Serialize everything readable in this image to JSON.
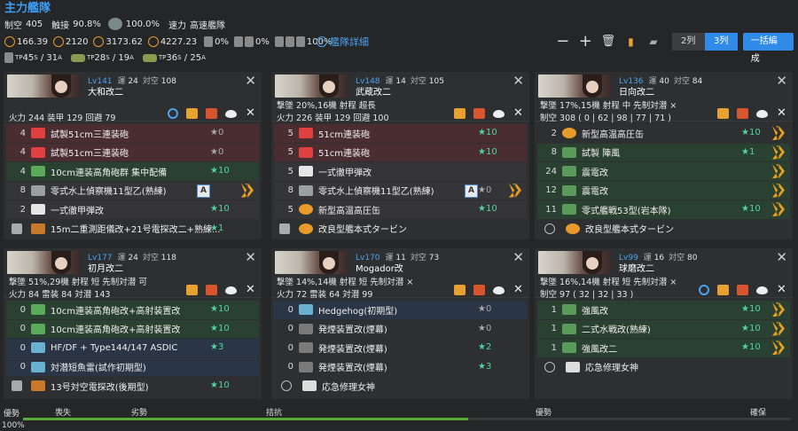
{
  "fleet": {
    "title": "主力艦隊",
    "stats": [
      {
        "label": "制空",
        "value": "405"
      },
      {
        "label": "触接",
        "value": "90.8%"
      },
      {
        "label": "",
        "value": "100.0%"
      },
      {
        "label": "速力",
        "value": "高速艦隊"
      }
    ],
    "los": [
      "166.39",
      "2120",
      "3173.62",
      "4227.23"
    ],
    "trans": [
      "0%",
      "0%",
      "100%"
    ],
    "tp": [
      "45",
      "31",
      "28",
      "19",
      "36",
      "25"
    ],
    "detail": "艦隊詳細",
    "col2": "2列",
    "col3": "3列",
    "form": "一括編成"
  },
  "ships": [
    {
      "lv": "Lv141",
      "unlabel": "運",
      "un": "24",
      "aalabel": "対空",
      "aa": "108",
      "name": "大和改二",
      "s1": "火力 244 装甲 129 回避 79",
      "s2": "",
      "slots": [
        {
          "c": "4",
          "n": "試製51cm三連装砲",
          "i": "★0",
          "k": "red",
          "ic": "gun",
          "g": 0
        },
        {
          "c": "4",
          "n": "試製51cm三連装砲",
          "i": "★0",
          "k": "red",
          "ic": "gun",
          "g": 0
        },
        {
          "c": "4",
          "n": "10cm連装高角砲群 集中配備",
          "i": "★10",
          "k": "grn",
          "ic": "aa",
          "g": 1
        },
        {
          "c": "8",
          "n": "零式水上偵察機11型乙(熟練)",
          "i": "",
          "k": "gry",
          "ic": "sea",
          "g": 0,
          "a": "A",
          "r": 1
        },
        {
          "c": "2",
          "n": "一式徹甲弾改",
          "i": "★10",
          "k": "gry",
          "ic": "drop",
          "g": 1
        },
        {
          "c": "",
          "n": "15m二重測距儀改+21号電探改二+熟練...",
          "i": "★1",
          "k": "dark",
          "ic": "radar",
          "g": 1,
          "w": 1
        }
      ]
    },
    {
      "lv": "Lv148",
      "unlabel": "運",
      "un": "14",
      "aalabel": "対空",
      "aa": "105",
      "name": "武蔵改二",
      "s1": "撃墜 20%,16機 射程 超長",
      "s2": "火力 226 装甲 129 回避 100",
      "slots": [
        {
          "c": "5",
          "n": "51cm連装砲",
          "i": "★10",
          "k": "red",
          "ic": "gun",
          "g": 1
        },
        {
          "c": "5",
          "n": "51cm連装砲",
          "i": "★10",
          "k": "red",
          "ic": "gun",
          "g": 1
        },
        {
          "c": "5",
          "n": "一式徹甲弾改",
          "i": "",
          "k": "gry",
          "ic": "drop",
          "g": 0
        },
        {
          "c": "8",
          "n": "零式水上偵察機11型乙(熟練)",
          "i": "★0",
          "k": "gry",
          "ic": "sea",
          "g": 0,
          "a": "A",
          "r": 1
        },
        {
          "c": "5",
          "n": "新型高温高圧缶",
          "i": "★10",
          "k": "gry",
          "ic": "aux",
          "g": 1
        },
        {
          "c": "",
          "n": "改良型艦本式タービン",
          "i": "",
          "k": "dark",
          "ic": "aux",
          "g": 0,
          "w": 1
        }
      ]
    },
    {
      "lv": "Lv136",
      "unlabel": "運",
      "un": "40",
      "aalabel": "対空",
      "aa": "84",
      "name": "日向改二",
      "s1": "撃墜 17%,15機 射程 中 先制対潜 ×",
      "s2": "制空 308 ( 0 | 62 | 98 | 77 | 71 )",
      "slots": [
        {
          "c": "2",
          "n": "新型高温高圧缶",
          "i": "★10",
          "k": "dark",
          "ic": "aux",
          "g": 1,
          "r": 1
        },
        {
          "c": "8",
          "n": "試製 陣風",
          "i": "★1",
          "k": "grn",
          "ic": "fight",
          "g": 1,
          "r": 1
        },
        {
          "c": "24",
          "n": "震電改",
          "i": "",
          "k": "grn",
          "ic": "fight",
          "g": 0,
          "r": 1
        },
        {
          "c": "12",
          "n": "震電改",
          "i": "",
          "k": "grn",
          "ic": "fight",
          "g": 0,
          "r": 1
        },
        {
          "c": "11",
          "n": "零式艦戦53型(岩本隊)",
          "i": "★10",
          "k": "grn",
          "ic": "fight",
          "g": 1,
          "r": 1
        },
        {
          "c": "",
          "n": "改良型艦本式タービン",
          "i": "",
          "k": "dark",
          "ic": "aux",
          "g": 0,
          "ban": 1
        }
      ]
    },
    {
      "lv": "Lv177",
      "unlabel": "運",
      "un": "24",
      "aalabel": "対空",
      "aa": "118",
      "name": "初月改二",
      "s1": "撃墜 51%,29機 射程 短 先制対潜 可",
      "s2": "火力 84 雷装 84 対潜 143",
      "slots": [
        {
          "c": "0",
          "n": "10cm連装高角砲改+高射装置改",
          "i": "★10",
          "k": "grn",
          "ic": "aa",
          "g": 1
        },
        {
          "c": "0",
          "n": "10cm連装高角砲改+高射装置改",
          "i": "★10",
          "k": "grn",
          "ic": "aa",
          "g": 1
        },
        {
          "c": "0",
          "n": "HF/DF + Type144/147 ASDIC",
          "i": "★3",
          "k": "blu",
          "ic": "sonar",
          "g": 1
        },
        {
          "c": "0",
          "n": "対潜短魚雷(試作初期型)",
          "i": "",
          "k": "blu",
          "ic": "sonar",
          "g": 0
        },
        {
          "c": "",
          "n": "13号対空電探改(後期型)",
          "i": "★10",
          "k": "dark",
          "ic": "radar",
          "g": 1,
          "w": 1
        }
      ]
    },
    {
      "lv": "Lv170",
      "unlabel": "運",
      "un": "11",
      "aalabel": "対空",
      "aa": "73",
      "name": "Mogador改",
      "s1": "撃墜 14%,14機 射程 短 先制対潜 ×",
      "s2": "火力 72 雷装 64 対潜 99",
      "slots": [
        {
          "c": "0",
          "n": "Hedgehog(初期型)",
          "i": "★0",
          "k": "blu",
          "ic": "sonar",
          "g": 0
        },
        {
          "c": "0",
          "n": "発煙装置改(煙幕)",
          "i": "★0",
          "k": "dark",
          "ic": "dc",
          "g": 0
        },
        {
          "c": "0",
          "n": "発煙装置改(煙幕)",
          "i": "★2",
          "k": "dark",
          "ic": "dc",
          "g": 1
        },
        {
          "c": "0",
          "n": "発煙装置改(煙幕)",
          "i": "★3",
          "k": "dark",
          "ic": "dc",
          "g": 1
        },
        {
          "c": "",
          "n": "応急修理女神",
          "i": "",
          "k": "dark",
          "ic": "rep",
          "g": 0,
          "ban": 1
        }
      ]
    },
    {
      "lv": "Lv99",
      "unlabel": "運",
      "un": "16",
      "aalabel": "対空",
      "aa": "80",
      "name": "球磨改二",
      "s1": "撃墜 16%,14機 射程 短 先制対潜 ×",
      "s2": "制空 97 ( 32 | 32 | 33 )",
      "slots": [
        {
          "c": "1",
          "n": "強風改",
          "i": "★10",
          "k": "grn",
          "ic": "fight",
          "g": 1,
          "r": 1
        },
        {
          "c": "1",
          "n": "二式水戦改(熟練)",
          "i": "★10",
          "k": "grn",
          "ic": "fight",
          "g": 1,
          "r": 1
        },
        {
          "c": "1",
          "n": "強風改二",
          "i": "★10",
          "k": "grn",
          "ic": "fight",
          "g": 1,
          "r": 1
        },
        {
          "c": "",
          "n": "応急修理女神",
          "i": "",
          "k": "dark",
          "ic": "rep",
          "g": 0,
          "ban": 1
        }
      ]
    }
  ],
  "airbar": {
    "labels": [
      "優勢",
      "喪失",
      "劣勢",
      "拮抗",
      "優勢",
      "確保"
    ],
    "value": "100%",
    "fill": 0.58
  }
}
